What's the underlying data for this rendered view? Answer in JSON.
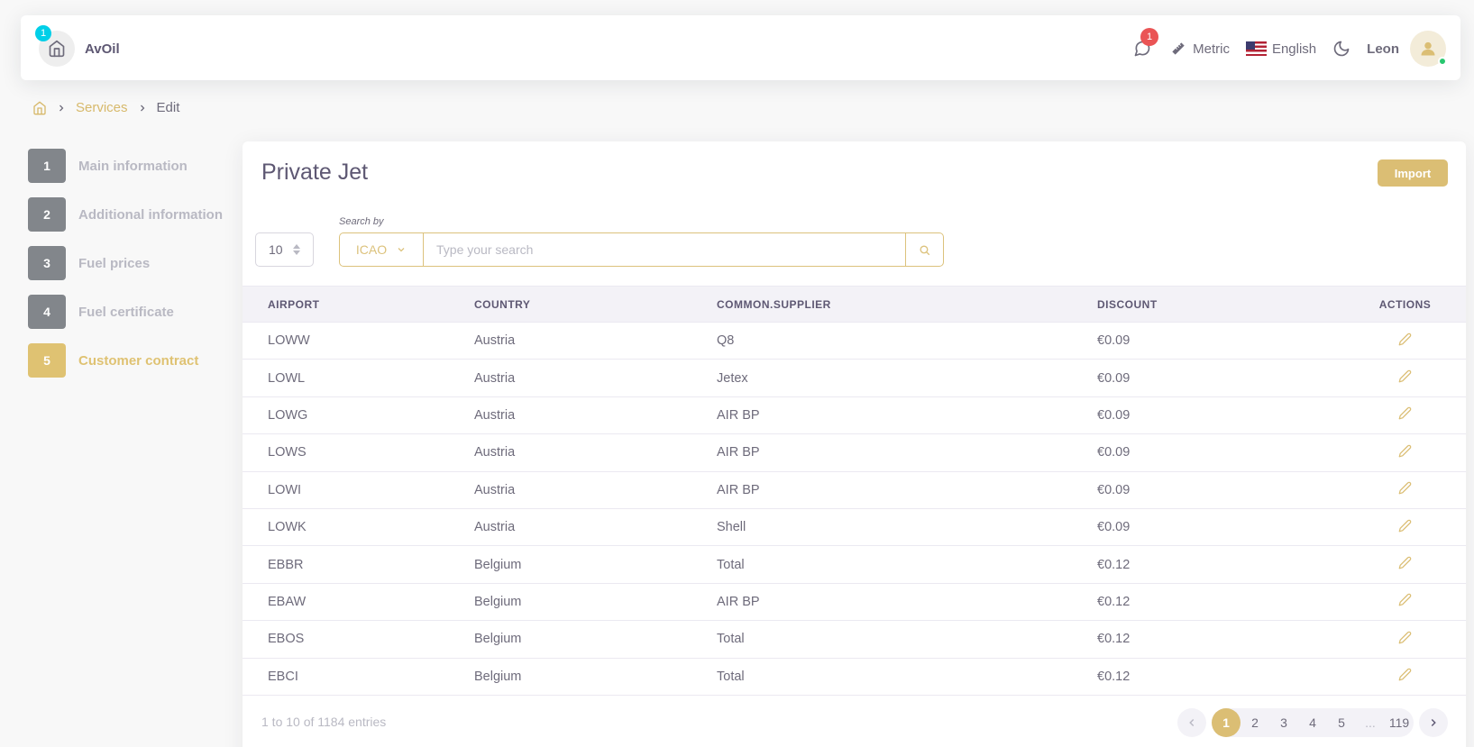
{
  "header": {
    "brand_name": "AvOil",
    "home_badge": "1",
    "notification_count": "1",
    "unit_system": "Metric",
    "language": "English",
    "user_name": "Leon"
  },
  "breadcrumb": {
    "items": [
      {
        "label": "Services"
      },
      {
        "label": "Edit"
      }
    ]
  },
  "steps": [
    {
      "number": "1",
      "label": "Main information"
    },
    {
      "number": "2",
      "label": "Additional information"
    },
    {
      "number": "3",
      "label": "Fuel prices"
    },
    {
      "number": "4",
      "label": "Fuel certificate"
    },
    {
      "number": "5",
      "label": "Customer contract",
      "active": true
    }
  ],
  "card": {
    "title": "Private Jet",
    "import_label": "Import"
  },
  "controls": {
    "page_length": "10",
    "search_label": "Search by",
    "search_by_value": "ICAO",
    "search_placeholder": "Type your search"
  },
  "table": {
    "columns": [
      "AIRPORT",
      "COUNTRY",
      "COMMON.SUPPLIER",
      "DISCOUNT",
      "ACTIONS"
    ],
    "rows": [
      {
        "airport": "LOWW",
        "country": "Austria",
        "supplier": "Q8",
        "discount": "€0.09"
      },
      {
        "airport": "LOWL",
        "country": "Austria",
        "supplier": "Jetex",
        "discount": "€0.09"
      },
      {
        "airport": "LOWG",
        "country": "Austria",
        "supplier": "AIR BP",
        "discount": "€0.09"
      },
      {
        "airport": "LOWS",
        "country": "Austria",
        "supplier": "AIR BP",
        "discount": "€0.09"
      },
      {
        "airport": "LOWI",
        "country": "Austria",
        "supplier": "AIR BP",
        "discount": "€0.09"
      },
      {
        "airport": "LOWK",
        "country": "Austria",
        "supplier": "Shell",
        "discount": "€0.09"
      },
      {
        "airport": "EBBR",
        "country": "Belgium",
        "supplier": "Total",
        "discount": "€0.12"
      },
      {
        "airport": "EBAW",
        "country": "Belgium",
        "supplier": "AIR BP",
        "discount": "€0.12"
      },
      {
        "airport": "EBOS",
        "country": "Belgium",
        "supplier": "Total",
        "discount": "€0.12"
      },
      {
        "airport": "EBCI",
        "country": "Belgium",
        "supplier": "Total",
        "discount": "€0.12"
      }
    ]
  },
  "footer": {
    "entries_info": "1 to 10 of 1184 entries",
    "pages": [
      "1",
      "2",
      "3",
      "4",
      "5",
      "...",
      "119"
    ],
    "active_page": "1"
  },
  "colors": {
    "accent": "#dbbe74",
    "step_inactive": "#82868b",
    "badge_info": "#00cfe8",
    "badge_danger": "#ea5455",
    "online": "#28c76f"
  }
}
